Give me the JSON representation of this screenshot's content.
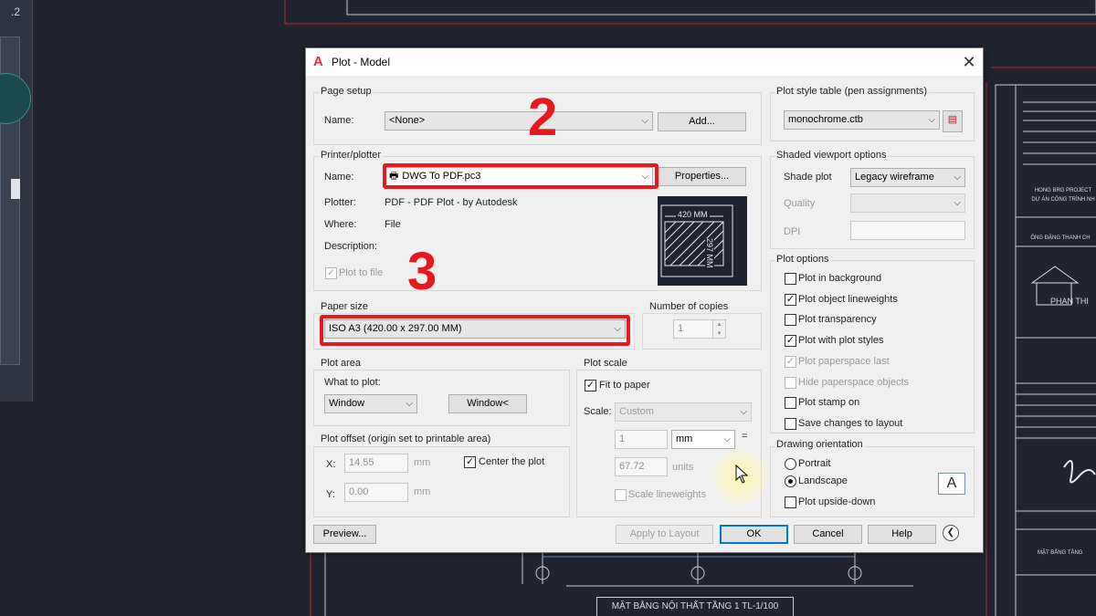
{
  "background": {
    "corner_number": ".2",
    "bottom_title": "MẶT BẰNG NỘI THẤT TẦNG 1 TL-1/100",
    "right_panel_lines": [
      "HONG BRG PROJECT",
      "DỰ ÁN CÔNG TRÌNH NH",
      "ÔNG ĐẶNG THANH CH",
      "PHAN THI",
      "MẶT BẰNG TẦNG"
    ],
    "colors": {
      "canvas": "#1f2430",
      "drawing_line": "#c03030"
    }
  },
  "dialog": {
    "title": "Plot - Model",
    "page_setup": {
      "group_label": "Page setup",
      "name_label": "Name:",
      "name_value": "<None>",
      "add_button": "Add..."
    },
    "printer": {
      "group_label": "Printer/plotter",
      "name_label": "Name:",
      "name_value": "DWG To PDF.pc3",
      "properties_button": "Properties...",
      "plotter_label": "Plotter:",
      "plotter_value": "PDF - PDF Plot - by Autodesk",
      "where_label": "Where:",
      "where_value": "File",
      "description_label": "Description:",
      "plot_to_file_label": "Plot to file",
      "preview_width": "420  MM",
      "preview_height": "297 MM"
    },
    "paper_size": {
      "group_label": "Paper size",
      "value": "ISO A3 (420.00 x 297.00 MM)"
    },
    "copies": {
      "group_label": "Number of copies",
      "value": "1"
    },
    "plot_area": {
      "group_label": "Plot area",
      "what_label": "What to plot:",
      "what_value": "Window",
      "window_button": "Window<"
    },
    "plot_offset": {
      "group_label": "Plot offset (origin set to printable area)",
      "x_label": "X:",
      "x_value": "14.55",
      "x_unit": "mm",
      "y_label": "Y:",
      "y_value": "0.00",
      "y_unit": "mm",
      "center_label": "Center the plot"
    },
    "plot_scale": {
      "group_label": "Plot scale",
      "fit_label": "Fit to paper",
      "scale_label": "Scale:",
      "scale_value": "Custom",
      "num_value": "1",
      "unit_value": "mm",
      "equals": "=",
      "den_value": "67.72",
      "den_unit": "units",
      "lineweights_label": "Scale lineweights"
    },
    "plot_style": {
      "group_label": "Plot style table (pen assignments)",
      "value": "monochrome.ctb"
    },
    "shaded": {
      "group_label": "Shaded viewport options",
      "shade_label": "Shade plot",
      "shade_value": "Legacy wireframe",
      "quality_label": "Quality",
      "dpi_label": "DPI"
    },
    "plot_options": {
      "group_label": "Plot options",
      "items": [
        {
          "label": "Plot in background",
          "checked": false,
          "enabled": true
        },
        {
          "label": "Plot object lineweights",
          "checked": true,
          "enabled": true
        },
        {
          "label": "Plot transparency",
          "checked": false,
          "enabled": true
        },
        {
          "label": "Plot with plot styles",
          "checked": true,
          "enabled": true
        },
        {
          "label": "Plot paperspace last",
          "checked": true,
          "enabled": false
        },
        {
          "label": "Hide paperspace objects",
          "checked": false,
          "enabled": false
        },
        {
          "label": "Plot stamp on",
          "checked": false,
          "enabled": true
        },
        {
          "label": "Save changes to layout",
          "checked": false,
          "enabled": true
        }
      ]
    },
    "orientation": {
      "group_label": "Drawing orientation",
      "portrait": "Portrait",
      "landscape": "Landscape",
      "upside_down": "Plot upside-down",
      "selected": "Landscape",
      "icon_letter": "A"
    },
    "buttons": {
      "preview": "Preview...",
      "apply": "Apply to Layout",
      "ok": "OK",
      "cancel": "Cancel",
      "help": "Help"
    }
  },
  "annotations": {
    "step_2": "2",
    "step_3": "3",
    "highlight_color": "#e8191e"
  }
}
